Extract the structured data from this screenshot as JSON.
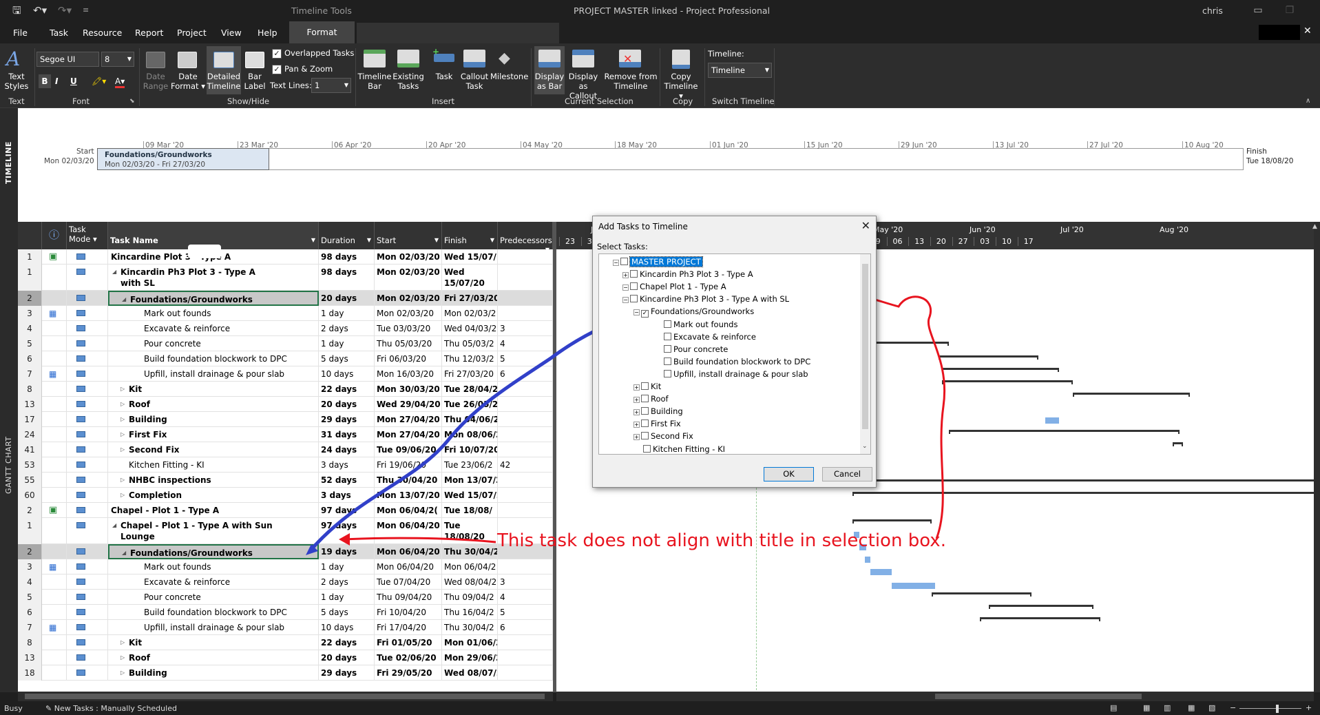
{
  "titlebar": {
    "context": "Timeline Tools",
    "title": "PROJECT MASTER linked  -  Project Professional",
    "user": "chris"
  },
  "menu": [
    "File",
    "Task",
    "Resource",
    "Report",
    "Project",
    "View",
    "Help"
  ],
  "active_tab": "Format",
  "ribbon": {
    "text_styles": "Text\nStyles",
    "font_name": "Segoe UI",
    "font_size": "8",
    "bold": "B",
    "italic": "I",
    "underline": "U",
    "date_range": "Date\nRange",
    "date_format": "Date\nFormat ▾",
    "detailed_timeline": "Detailed\nTimeline",
    "bar_label": "Bar\nLabel",
    "overlapped_tasks": "Overlapped Tasks",
    "pan_zoom": "Pan & Zoom",
    "text_lines_label": "Text Lines:",
    "text_lines_value": "1",
    "timeline_bar": "Timeline\nBar",
    "existing_tasks": "Existing\nTasks",
    "task": "Task",
    "callout_task": "Callout\nTask",
    "milestone": "Milestone",
    "display_as_bar": "Display\nas Bar",
    "display_as_callout": "Display\nas Callout",
    "remove_from_timeline": "Remove from\nTimeline",
    "copy_timeline": "Copy\nTimeline ▾",
    "timeline_label": "Timeline:",
    "timeline_value": "Timeline",
    "groups": {
      "text": "Text",
      "font": "Font",
      "show_hide": "Show/Hide",
      "insert": "Insert",
      "current_selection": "Current Selection",
      "copy": "Copy",
      "switch_timeline": "Switch Timeline"
    }
  },
  "timeline": {
    "side_label": "TIMELINE",
    "start_label": "Start",
    "start_date": "Mon 02/03/20",
    "finish_label": "Finish",
    "finish_date": "Tue 18/08/20",
    "ticks": [
      "09 Mar '20",
      "23 Mar '20",
      "06 Apr '20",
      "20 Apr '20",
      "04 May '20",
      "18 May '20",
      "01 Jun '20",
      "15 Jun '20",
      "29 Jun '20",
      "13 Jul '20",
      "27 Jul '20",
      "10 Aug '20"
    ],
    "task_name": "Foundations/Groundworks",
    "task_dates": "Mon 02/03/20 - Fri 27/03/20"
  },
  "grid": {
    "side_label": "GANTT CHART",
    "headers": {
      "mode": "Task\nMode ▾",
      "name": "Task Name",
      "duration": "Duration",
      "start": "Start",
      "finish": "Finish",
      "pred": "Predecessors"
    },
    "rows": [
      {
        "id": "1",
        "name": "Kincardine          Plot 3 - Type A",
        "dur": "98 days",
        "start": "Mon 02/03/20",
        "finish": "Wed 15/07/",
        "pred": "",
        "lvl": 0,
        "bold": true,
        "tri": "◢",
        "ico": "proj"
      },
      {
        "id": "1",
        "name": "Kincardin          Ph3 Plot 3 - Type A",
        "name2": "with SL",
        "dur": "98 days",
        "start": "Mon 02/03/20",
        "finish": "Wed",
        "finish2": "15/07/20",
        "pred": "",
        "lvl": 1,
        "bold": true,
        "tri": "◢",
        "tall": true
      },
      {
        "id": "2",
        "name": "Foundations/Groundworks",
        "dur": "20 days",
        "start": "Mon 02/03/20",
        "finish": "Fri 27/03/20",
        "pred": "",
        "lvl": 2,
        "bold": true,
        "tri": "◢",
        "sel": true
      },
      {
        "id": "3",
        "name": "Mark out founds",
        "dur": "1 day",
        "start": "Mon 02/03/20",
        "finish": "Mon 02/03/2",
        "pred": "",
        "lvl": 3,
        "ico": "cal"
      },
      {
        "id": "4",
        "name": "Excavate & reinforce",
        "dur": "2 days",
        "start": "Tue 03/03/20",
        "finish": "Wed 04/03/2",
        "pred": "3",
        "lvl": 3
      },
      {
        "id": "5",
        "name": "Pour concrete",
        "dur": "1 day",
        "start": "Thu 05/03/20",
        "finish": "Thu 05/03/2",
        "pred": "4",
        "lvl": 3
      },
      {
        "id": "6",
        "name": "Build foundation blockwork to DPC",
        "dur": "5 days",
        "start": "Fri 06/03/20",
        "finish": "Thu 12/03/2",
        "pred": "5",
        "lvl": 3
      },
      {
        "id": "7",
        "name": "Upfill, install drainage & pour slab",
        "dur": "10 days",
        "start": "Mon 16/03/20",
        "finish": "Fri 27/03/20",
        "pred": "6",
        "lvl": 3,
        "ico": "cal"
      },
      {
        "id": "8",
        "name": "Kit",
        "dur": "22 days",
        "start": "Mon 30/03/20",
        "finish": "Tue 28/04/2",
        "pred": "",
        "lvl": 2,
        "bold": true,
        "tri": "▷"
      },
      {
        "id": "13",
        "name": "Roof",
        "dur": "20 days",
        "start": "Wed 29/04/20",
        "finish": "Tue 26/05/2",
        "pred": "",
        "lvl": 2,
        "bold": true,
        "tri": "▷"
      },
      {
        "id": "17",
        "name": "Building",
        "dur": "29 days",
        "start": "Mon 27/04/20",
        "finish": "Thu 04/06/2",
        "pred": "",
        "lvl": 2,
        "bold": true,
        "tri": "▷"
      },
      {
        "id": "24",
        "name": "First Fix",
        "dur": "31 days",
        "start": "Mon 27/04/20",
        "finish": "Mon 08/06/2",
        "pred": "",
        "lvl": 2,
        "bold": true,
        "tri": "▷"
      },
      {
        "id": "41",
        "name": "Second Fix",
        "dur": "24 days",
        "start": "Tue 09/06/20",
        "finish": "Fri 10/07/20",
        "pred": "",
        "lvl": 2,
        "bold": true,
        "tri": "▷"
      },
      {
        "id": "53",
        "name": "Kitchen Fitting - KI",
        "dur": "3 days",
        "start": "Fri 19/06/20",
        "finish": "Tue 23/06/2",
        "pred": "42",
        "lvl": 2
      },
      {
        "id": "55",
        "name": "NHBC inspections",
        "dur": "52 days",
        "start": "Thu 30/04/20",
        "finish": "Mon 13/07/2",
        "pred": "",
        "lvl": 2,
        "bold": true,
        "tri": "▷"
      },
      {
        "id": "60",
        "name": "Completion",
        "dur": "3 days",
        "start": "Mon 13/07/20",
        "finish": "Wed 15/07/2",
        "pred": "",
        "lvl": 2,
        "bold": true,
        "tri": "▷"
      },
      {
        "id": "2",
        "name": "Chapel          - Plot 1 - Type A",
        "dur": "97 days",
        "start": "Mon 06/04/2(",
        "finish": "Tue 18/08/",
        "pred": "",
        "lvl": 0,
        "bold": true,
        "tri": "◢",
        "ico": "proj"
      },
      {
        "id": "1",
        "name": "Chapel          - Plot 1 - Type A with Sun",
        "name2": "Lounge",
        "dur": "97 days",
        "start": "Mon 06/04/20",
        "finish": "Tue",
        "finish2": "18/08/20",
        "pred": "",
        "lvl": 1,
        "bold": true,
        "tri": "◢",
        "tall": true
      },
      {
        "id": "2",
        "name": "Foundations/Groundworks",
        "dur": "19 days",
        "start": "Mon 06/04/20",
        "finish": "Thu 30/04/20",
        "pred": "",
        "lvl": 2,
        "bold": true,
        "tri": "◢",
        "sel": true
      },
      {
        "id": "3",
        "name": "Mark out founds",
        "dur": "1 day",
        "start": "Mon 06/04/20",
        "finish": "Mon 06/04/2",
        "pred": "",
        "lvl": 3,
        "ico": "cal"
      },
      {
        "id": "4",
        "name": "Excavate & reinforce",
        "dur": "2 days",
        "start": "Tue 07/04/20",
        "finish": "Wed 08/04/2",
        "pred": "3",
        "lvl": 3
      },
      {
        "id": "5",
        "name": "Pour concrete",
        "dur": "1 day",
        "start": "Thu 09/04/20",
        "finish": "Thu 09/04/2",
        "pred": "4",
        "lvl": 3
      },
      {
        "id": "6",
        "name": "Build foundation blockwork to DPC",
        "dur": "5 days",
        "start": "Fri 10/04/20",
        "finish": "Thu 16/04/2",
        "pred": "5",
        "lvl": 3
      },
      {
        "id": "7",
        "name": "Upfill, install drainage & pour slab",
        "dur": "10 days",
        "start": "Fri 17/04/20",
        "finish": "Thu 30/04/2",
        "pred": "6",
        "lvl": 3,
        "ico": "cal"
      },
      {
        "id": "8",
        "name": "Kit",
        "dur": "22 days",
        "start": "Fri 01/05/20",
        "finish": "Mon 01/06/2",
        "pred": "",
        "lvl": 2,
        "bold": true,
        "tri": "▷"
      },
      {
        "id": "13",
        "name": "Roof",
        "dur": "20 days",
        "start": "Tue 02/06/20",
        "finish": "Mon 29/06/2",
        "pred": "",
        "lvl": 2,
        "bold": true,
        "tri": "▷"
      },
      {
        "id": "18",
        "name": "Building",
        "dur": "29 days",
        "start": "Fri 29/05/20",
        "finish": "Wed 08/07/2",
        "pred": "",
        "lvl": 2,
        "bold": true,
        "tri": "▷"
      }
    ]
  },
  "chart": {
    "months": [
      "Ju",
      "May '20",
      "Jun '20",
      "Jul '20",
      "Aug '20"
    ],
    "days": [
      "23",
      "30",
      "06",
      "13",
      "20",
      "27",
      "04",
      "11",
      "18",
      "25",
      "01",
      "08",
      "15",
      "22",
      "29",
      "06",
      "13",
      "20",
      "27",
      "03",
      "10",
      "17"
    ]
  },
  "dialog": {
    "title": "Add Tasks to Timeline",
    "close": "✕",
    "select_label": "Select Tasks:",
    "items": [
      {
        "t": "MASTER PROJECT",
        "lvl": 0,
        "exp": "⊟",
        "sel": true
      },
      {
        "t": "Kincardin          Ph3 Plot 3 - Type A",
        "lvl": 1,
        "exp": "⊞"
      },
      {
        "t": "Chapel          Plot 1 - Type A",
        "lvl": 1,
        "exp": "⊟"
      },
      {
        "t": "Kincardine          Ph3 Plot 3 - Type A with SL",
        "lvl": 2,
        "exp": "⊟"
      },
      {
        "t": "Foundations/Groundworks",
        "lvl": 3,
        "exp": "⊟",
        "checked": true
      },
      {
        "t": "Mark out founds",
        "lvl": 4
      },
      {
        "t": "Excavate & reinforce",
        "lvl": 4
      },
      {
        "t": "Pour concrete",
        "lvl": 4
      },
      {
        "t": "Build foundation blockwork to DPC",
        "lvl": 4
      },
      {
        "t": "Upfill, install drainage & pour slab",
        "lvl": 4
      },
      {
        "t": "Kit",
        "lvl": 3,
        "exp": "⊞"
      },
      {
        "t": "Roof",
        "lvl": 3,
        "exp": "⊞"
      },
      {
        "t": "Building",
        "lvl": 3,
        "exp": "⊞"
      },
      {
        "t": "First Fix",
        "lvl": 3,
        "exp": "⊞"
      },
      {
        "t": "Second Fix",
        "lvl": 3,
        "exp": "⊞"
      },
      {
        "t": "Kitchen Fitting - KI",
        "lvl": 3
      }
    ],
    "ok": "OK",
    "cancel": "Cancel"
  },
  "annotation": "This task does not align with title in selection box.",
  "status": {
    "busy": "Busy",
    "new_tasks": "New Tasks : Manually Scheduled"
  },
  "colors": {
    "accent": "#4f81bd",
    "annotation_red": "#e8141f",
    "annotation_blue": "#2f3fc7"
  }
}
